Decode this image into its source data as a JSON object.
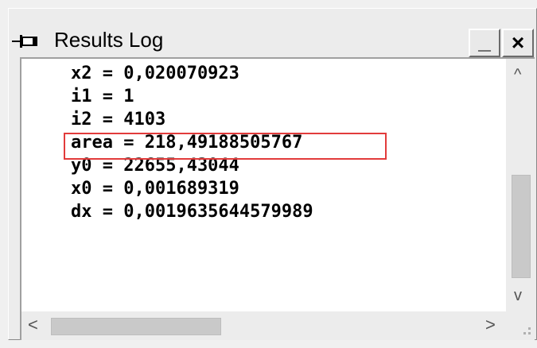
{
  "window": {
    "title": "Results Log",
    "minimize_glyph": "_",
    "close_glyph": "×"
  },
  "log": {
    "lines": [
      "x2 = 0,020070923",
      "i1 = 1",
      "i2 = 4103",
      "area = 218,49188505767",
      "y0 = 22655,43044",
      "x0 = 0,001689319",
      "dx = 0,0019635644579989"
    ],
    "highlighted_line_index": 3,
    "highlight_color": "#e23b3b"
  },
  "scrollbars": {
    "up_arrow": "^",
    "down_arrow": "v",
    "left_arrow": "<",
    "right_arrow": ">"
  }
}
